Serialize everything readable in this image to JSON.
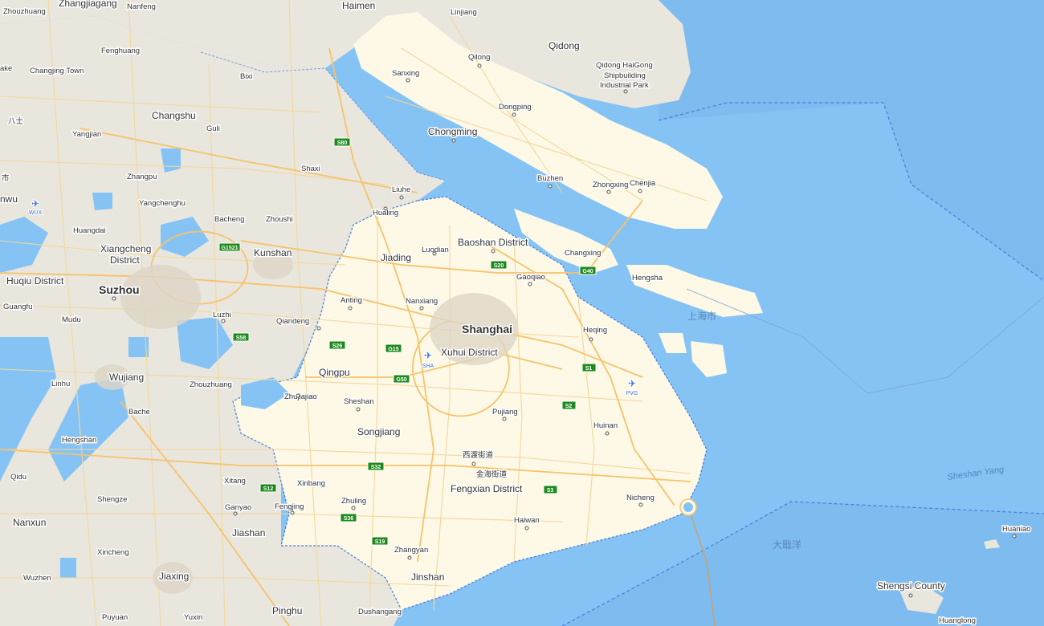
{
  "map": {
    "colors": {
      "sea": "#85c3f5",
      "land": "#e9e6de",
      "shanghai_land": "#fdf9e6",
      "highway": "#f7c26a",
      "road": "#f3d79a",
      "boundary": "#4a7bd9",
      "shield": "#1c8a1c"
    },
    "labels": [
      {
        "id": "shanghai",
        "text": "Shanghai",
        "cls": "city-major"
      },
      {
        "id": "suzhou",
        "text": "Suzhou",
        "cls": "city-major"
      },
      {
        "id": "baoshan",
        "text": "Baoshan District",
        "cls": "city"
      },
      {
        "id": "xuhui",
        "text": "Xuhui District",
        "cls": "city"
      },
      {
        "id": "fengxian",
        "text": "Fengxian District",
        "cls": "city"
      },
      {
        "id": "chongming",
        "text": "Chongming",
        "cls": "city"
      },
      {
        "id": "jiading",
        "text": "Jiading",
        "cls": "city"
      },
      {
        "id": "qingpu",
        "text": "Qingpu",
        "cls": "city"
      },
      {
        "id": "songjiang",
        "text": "Songjiang",
        "cls": "city"
      },
      {
        "id": "jinshan",
        "text": "Jinshan",
        "cls": "city"
      },
      {
        "id": "kunshan",
        "text": "Kunshan",
        "cls": "city"
      },
      {
        "id": "changshu",
        "text": "Changshu",
        "cls": "city"
      },
      {
        "id": "qidong",
        "text": "Qidong",
        "cls": "city"
      },
      {
        "id": "haimen",
        "text": "Haimen",
        "cls": "city"
      },
      {
        "id": "wujiang",
        "text": "Wujiang",
        "cls": "city"
      },
      {
        "id": "jiashan",
        "text": "Jiashan",
        "cls": "city"
      },
      {
        "id": "jiaxing",
        "text": "Jiaxing",
        "cls": "city"
      },
      {
        "id": "pinghu",
        "text": "Pinghu",
        "cls": "city"
      },
      {
        "id": "nanxun",
        "text": "Nanxun",
        "cls": "city"
      },
      {
        "id": "huqiu",
        "text": "Huqiu District",
        "cls": "city"
      },
      {
        "id": "xiangcheng1",
        "text": "Xiangcheng",
        "cls": "city"
      },
      {
        "id": "xiangcheng2",
        "text": "District",
        "cls": "city"
      },
      {
        "id": "zhangjiagang",
        "text": "Zhangjiagang",
        "cls": "city"
      },
      {
        "id": "shengsi",
        "text": "Shengsi County",
        "cls": "city"
      },
      {
        "id": "zhouzhuang_n",
        "text": "Zhouzhuang",
        "cls": "town"
      },
      {
        "id": "nanfeng",
        "text": "Nanfeng",
        "cls": "town"
      },
      {
        "id": "linjiang",
        "text": "Linjiang",
        "cls": "town"
      },
      {
        "id": "fenghuang",
        "text": "Fenghuang",
        "cls": "town"
      },
      {
        "id": "changjing",
        "text": "Changjing Town",
        "cls": "town"
      },
      {
        "id": "bixi",
        "text": "Bixi",
        "cls": "town"
      },
      {
        "id": "qilong",
        "text": "Qilong",
        "cls": "town"
      },
      {
        "id": "haigong1",
        "text": "Qidong HaiGong",
        "cls": "town"
      },
      {
        "id": "haigong2",
        "text": "Shipbuilding",
        "cls": "town"
      },
      {
        "id": "haigong3",
        "text": "Industrial Park",
        "cls": "town"
      },
      {
        "id": "sanxing",
        "text": "Sanxing",
        "cls": "town"
      },
      {
        "id": "dongping",
        "text": "Dongping",
        "cls": "town"
      },
      {
        "id": "yangjian",
        "text": "Yangjian",
        "cls": "town"
      },
      {
        "id": "guli",
        "text": "Guli",
        "cls": "town"
      },
      {
        "id": "shaxi",
        "text": "Shaxi",
        "cls": "town"
      },
      {
        "id": "zhangpu",
        "text": "Zhangpu",
        "cls": "town"
      },
      {
        "id": "buzhen",
        "text": "Buzhen",
        "cls": "town"
      },
      {
        "id": "zhongxing",
        "text": "Zhongxing",
        "cls": "town"
      },
      {
        "id": "chenjia",
        "text": "Chenjia",
        "cls": "town"
      },
      {
        "id": "yangchenghu",
        "text": "Yangchenghu",
        "cls": "town"
      },
      {
        "id": "liuhe",
        "text": "Liuhe",
        "cls": "town"
      },
      {
        "id": "huating",
        "text": "Hualing",
        "cls": "town"
      },
      {
        "id": "bacheng",
        "text": "Bacheng",
        "cls": "town"
      },
      {
        "id": "zhoushi",
        "text": "Zhoushi",
        "cls": "town"
      },
      {
        "id": "huangdai",
        "text": "Huangdai",
        "cls": "town"
      },
      {
        "id": "luodian",
        "text": "Luodian",
        "cls": "town"
      },
      {
        "id": "changxing",
        "text": "Changxing",
        "cls": "town"
      },
      {
        "id": "hengsha",
        "text": "Hengsha",
        "cls": "town"
      },
      {
        "id": "gaoqiao",
        "text": "Gaoqiao",
        "cls": "town"
      },
      {
        "id": "anting",
        "text": "Anting",
        "cls": "town"
      },
      {
        "id": "nanxiang",
        "text": "Nanxiang",
        "cls": "town"
      },
      {
        "id": "guangfu",
        "text": "Guangfu",
        "cls": "town"
      },
      {
        "id": "mudu",
        "text": "Mudu",
        "cls": "town"
      },
      {
        "id": "luzhi",
        "text": "Luzhi",
        "cls": "town"
      },
      {
        "id": "qiandeng",
        "text": "Qiandeng",
        "cls": "town"
      },
      {
        "id": "heqing",
        "text": "Heqing",
        "cls": "town"
      },
      {
        "id": "zhouzhuang",
        "text": "Zhouzhuang",
        "cls": "town"
      },
      {
        "id": "zhujiajiao",
        "text": "Zhujiajiao",
        "cls": "town"
      },
      {
        "id": "linhu",
        "text": "Linhu",
        "cls": "town"
      },
      {
        "id": "bache",
        "text": "Bache",
        "cls": "town"
      },
      {
        "id": "sheshan",
        "text": "Sheshan",
        "cls": "town"
      },
      {
        "id": "pujiang",
        "text": "Pujiang",
        "cls": "town"
      },
      {
        "id": "huinan",
        "text": "Huinan",
        "cls": "town"
      },
      {
        "id": "hengshan",
        "text": "Hengshan",
        "cls": "town"
      },
      {
        "id": "xidu",
        "text": "西渡街道",
        "cls": "town"
      },
      {
        "id": "jinhai",
        "text": "金海街道",
        "cls": "town"
      },
      {
        "id": "qidu",
        "text": "Qidu",
        "cls": "town"
      },
      {
        "id": "xitang",
        "text": "Xitang",
        "cls": "town"
      },
      {
        "id": "xinbang",
        "text": "Xinbang",
        "cls": "town"
      },
      {
        "id": "zhuling",
        "text": "Zhuling",
        "cls": "town"
      },
      {
        "id": "fengjing",
        "text": "Fengjing",
        "cls": "town"
      },
      {
        "id": "ganyao",
        "text": "Ganyao",
        "cls": "town"
      },
      {
        "id": "shengze",
        "text": "Shengze",
        "cls": "town"
      },
      {
        "id": "nicheng",
        "text": "Nicheng",
        "cls": "town"
      },
      {
        "id": "haiwan",
        "text": "Haiwan",
        "cls": "town"
      },
      {
        "id": "zhangyan",
        "text": "Zhangyan",
        "cls": "town"
      },
      {
        "id": "xincheng",
        "text": "Xincheng",
        "cls": "town"
      },
      {
        "id": "wuzhen",
        "text": "Wuzhen",
        "cls": "town"
      },
      {
        "id": "puyuan",
        "text": "Puyuan",
        "cls": "town"
      },
      {
        "id": "yuxin",
        "text": "Yuxin",
        "cls": "town"
      },
      {
        "id": "dushangang",
        "text": "Dushangang",
        "cls": "town"
      },
      {
        "id": "huaniao",
        "text": "Huaniao",
        "cls": "town"
      },
      {
        "id": "huanglong",
        "text": "Huanglong",
        "cls": "town"
      },
      {
        "id": "shi8",
        "text": "八士",
        "cls": "town"
      },
      {
        "id": "edge_ke",
        "text": "ake",
        "cls": "town"
      },
      {
        "id": "edge_nwu",
        "text": "nwu",
        "cls": "city"
      },
      {
        "id": "edge_shi",
        "text": "市",
        "cls": "town"
      }
    ],
    "water_labels": [
      {
        "id": "shanghai_cn",
        "text": "上海市",
        "cls": "water-cn"
      },
      {
        "id": "sheshan_yang",
        "text": "Sheshan Yang",
        "cls": "water"
      },
      {
        "id": "daqu_yang",
        "text": "大戢洋",
        "cls": "water-cn"
      }
    ],
    "shields": [
      "S80",
      "G1521",
      "S58",
      "S26",
      "G15",
      "G50",
      "S20",
      "G40",
      "S1",
      "S2",
      "S32",
      "S12",
      "S36",
      "S19",
      "S3"
    ],
    "airports": [
      "WUX",
      "SHA",
      "PVG"
    ]
  }
}
